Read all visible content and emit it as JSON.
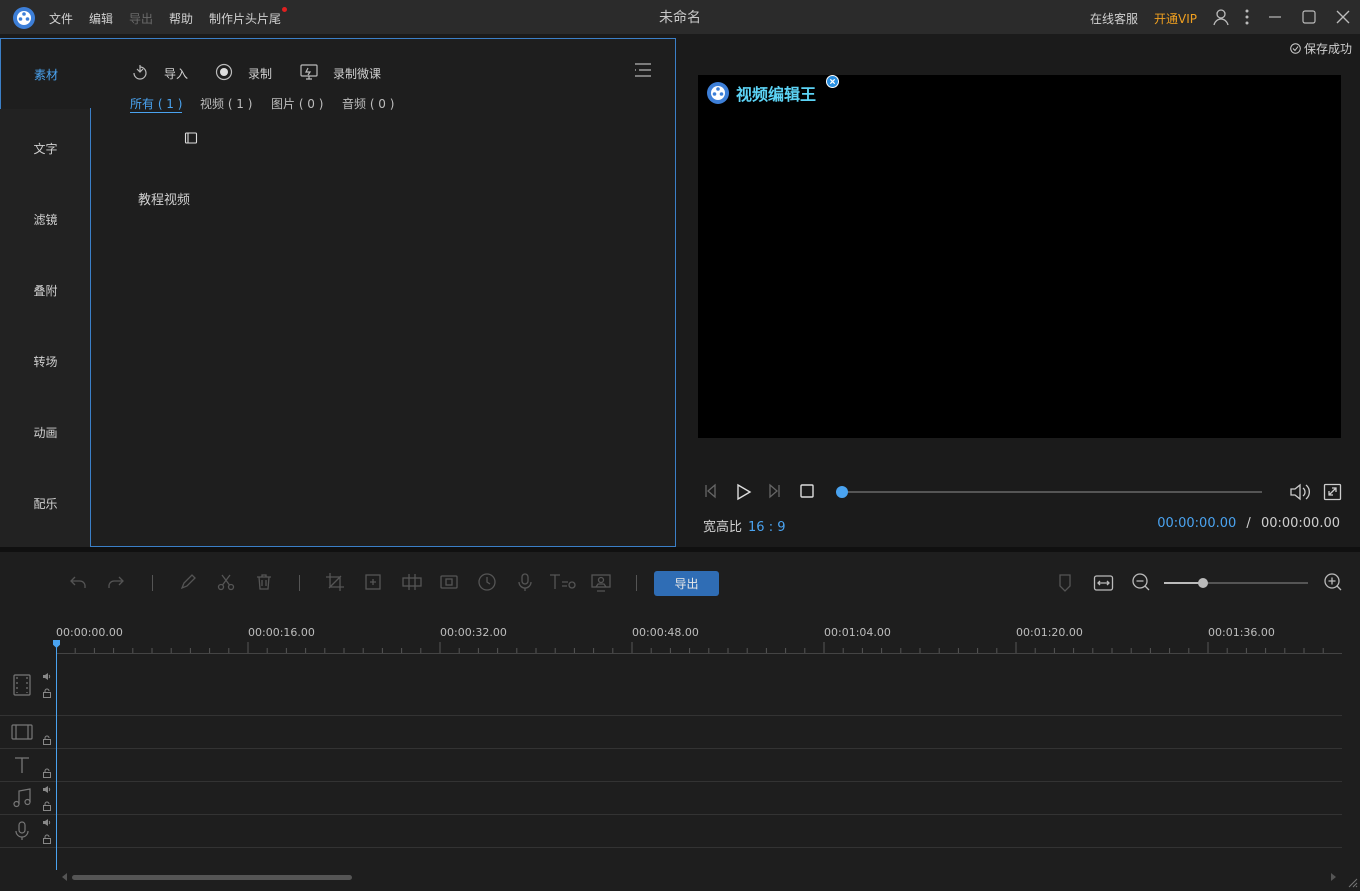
{
  "menu": {
    "file": "文件",
    "edit": "编辑",
    "export": "导出",
    "help": "帮助",
    "intro_outro": "制作片头片尾"
  },
  "window": {
    "title": "未命名",
    "online_service": "在线客服",
    "vip": "开通VIP"
  },
  "sidebar": {
    "items": [
      {
        "label": "素材"
      },
      {
        "label": "文字"
      },
      {
        "label": "滤镜"
      },
      {
        "label": "叠附"
      },
      {
        "label": "转场"
      },
      {
        "label": "动画"
      },
      {
        "label": "配乐"
      }
    ]
  },
  "media": {
    "import_label": "导入",
    "record_label": "录制",
    "record_lesson_label": "录制微课",
    "filters": [
      {
        "label": "所有 ( 1 )"
      },
      {
        "label": "视频 ( 1 )"
      },
      {
        "label": "图片 ( 0 )"
      },
      {
        "label": "音频 ( 0 )"
      }
    ],
    "items": [
      {
        "name": "教程视频"
      }
    ]
  },
  "preview": {
    "save_status": "保存成功",
    "watermark": "视频编辑王",
    "aspect_label": "宽高比",
    "aspect_value": "16 : 9",
    "current_time": "00:00:00.00",
    "separator": "/",
    "total_time": "00:00:00.00",
    "progress": 0
  },
  "toolbar": {
    "export_label": "导出",
    "zoom_level": 0.27
  },
  "timeline": {
    "ticks": [
      "00:00:00.00",
      "00:00:16.00",
      "00:00:32.00",
      "00:00:48.00",
      "00:01:04.00",
      "00:01:20.00",
      "00:01:36.00"
    ]
  },
  "colors": {
    "accent": "#4aa3f0",
    "vip": "#f0a020",
    "export_button": "#2f6db5",
    "watermark": "#5cd3f5"
  }
}
